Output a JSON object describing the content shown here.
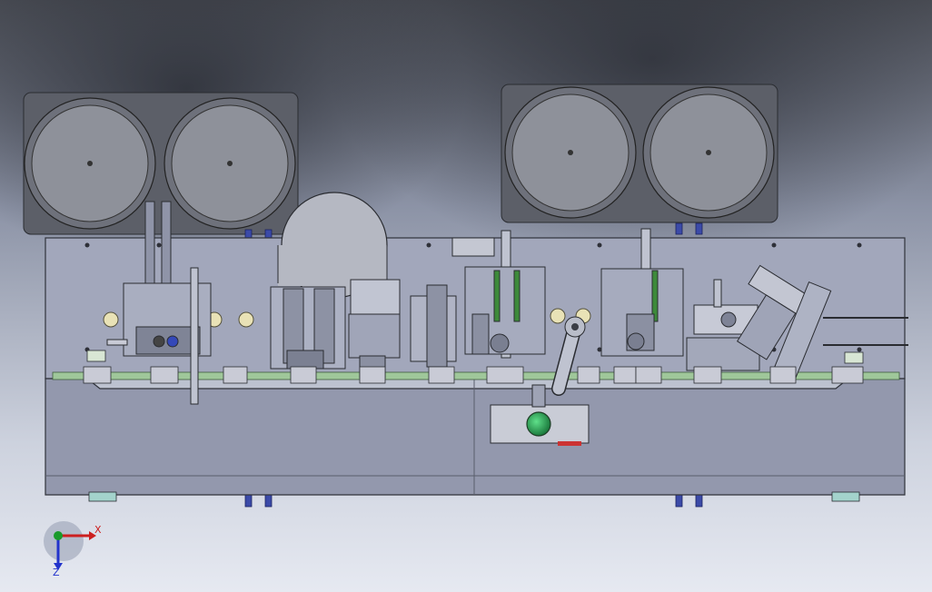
{
  "scene": {
    "description_label": "",
    "background": {
      "top": "#3a3d45",
      "mid": "#8a93aa",
      "bottom": "#dfe3ee"
    }
  },
  "colors": {
    "plate": "#9aa0b6",
    "plate_dark": "#7e849a",
    "bowl": "#b4b6be",
    "bowl_frame": "#6b6e78",
    "rail_green": "#9fc79a",
    "stop_button": "#2fa35a",
    "axis_x": "#cc1f1f",
    "axis_y": "#1a9a2a",
    "axis_z": "#2233cc"
  },
  "triad": {
    "x_label": "X",
    "z_label": "Z",
    "x_icon": "arrow-right-icon",
    "z_icon": "arrow-down-icon"
  }
}
